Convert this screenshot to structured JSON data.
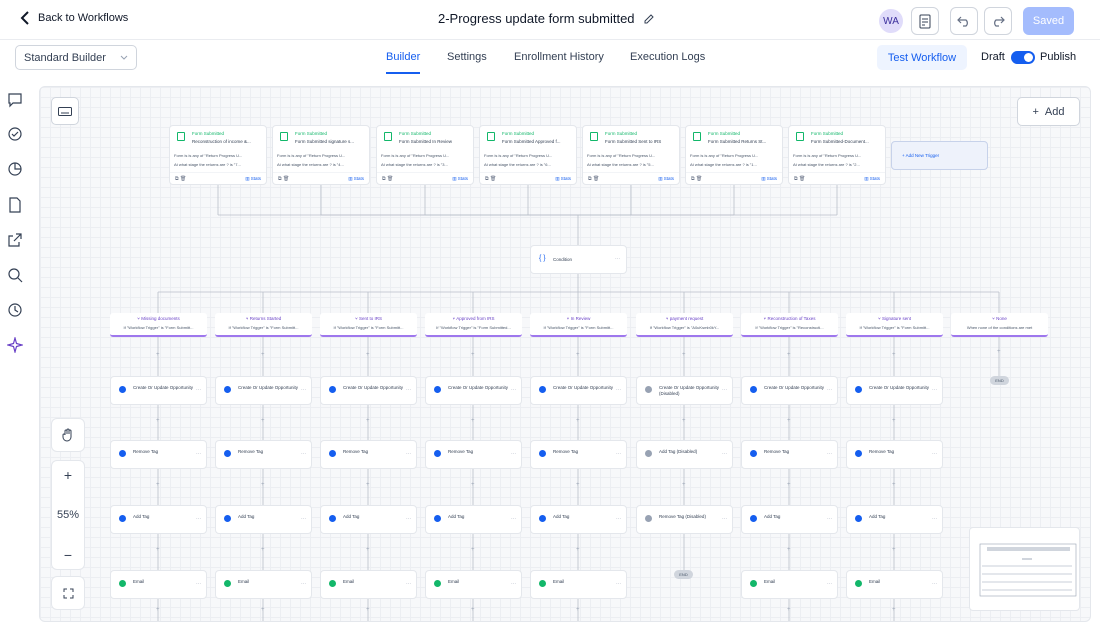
{
  "header": {
    "back_label": "Back to Workflows",
    "workflow_title": "2-Progress update form submitted",
    "avatar_initials": "WA",
    "saved_label": "Saved"
  },
  "subheader": {
    "builder_select": "Standard Builder",
    "tabs": [
      "Builder",
      "Settings",
      "Enrollment History",
      "Execution Logs"
    ],
    "active_tab": "Builder",
    "test_workflow": "Test Workflow",
    "draft_label": "Draft",
    "publish_label": "Publish"
  },
  "canvas": {
    "add_label": "Add",
    "zoom": "55%",
    "add_trigger": "Add New Trigger",
    "condition": "Condition",
    "stats": "Stats",
    "triggers": [
      {
        "type": "Form Submitted",
        "name": "Reconstruction of income &...",
        "line1": "Form is is any of \"Return Progress U...",
        "line2": "At what stage the returns are ? is \"7..."
      },
      {
        "type": "Form Submitted",
        "name": "Form Submitted signature s...",
        "line1": "Form is is any of \"Return Progress U...",
        "line2": "At what stage the returns are ? is \"4..."
      },
      {
        "type": "Form Submitted",
        "name": "Form Submitted In Review",
        "line1": "Form is is any of \"Return Progress U...",
        "line2": "At what stage the returns are ? is \"3..."
      },
      {
        "type": "Form Submitted",
        "name": "Form Submitted Approved f...",
        "line1": "Form is is any of \"Return Progress U...",
        "line2": "At what stage the returns are ? is \"6..."
      },
      {
        "type": "Form Submitted",
        "name": "Form Submitted Sent to IRS",
        "line1": "Form is is any of \"Return Progress U...",
        "line2": "At what stage the returns are ? is \"5..."
      },
      {
        "type": "Form Submitted",
        "name": "Form Submitted Returns St...",
        "line1": "Form is is any of \"Return Progress U...",
        "line2": "At what stage the returns are ? is \"1..."
      },
      {
        "type": "Form Submitted",
        "name": "Form Submitted-Document...",
        "line1": "Form is is any of \"Return Progress U...",
        "line2": "At what stage the returns are ? is \"2..."
      }
    ],
    "branches": [
      {
        "name": "Missing documents",
        "cond": "If \"Workflow Trigger\" is \"Form Submitt..."
      },
      {
        "name": "Returns Started",
        "cond": "If \"Workflow Trigger\" is \"Form Submitt..."
      },
      {
        "name": "Sent to IRS",
        "cond": "If \"Workflow Trigger\" is \"Form Submitt..."
      },
      {
        "name": "Approved from IRS",
        "cond": "If \"Workflow Trigger\" is \"Form Submitted..."
      },
      {
        "name": "In Review",
        "cond": "If \"Workflow Trigger\" is \"Form Submitt..."
      },
      {
        "name": "payment request",
        "cond": "If \"Workflow Trigger\" is \"A0uKsmb0kY..."
      },
      {
        "name": "Reconstruction of Taxes",
        "cond": "If \"Workflow Trigger\" is \"Reconstructi..."
      },
      {
        "name": "Signature sent",
        "cond": "If \"Workflow Trigger\" is \"Form Submitt..."
      },
      {
        "name": "None",
        "cond": "When none of the conditions are met"
      }
    ],
    "actions_row1": [
      "Create Or Update Opportunity",
      "Create Or Update Opportunity",
      "Create Or Update Opportunity",
      "Create Or Update Opportunity",
      "Create Or Update Opportunity",
      "Create Or Update Opportunity (Disabled)",
      "Create Or Update Opportunity",
      "Create Or Update Opportunity"
    ],
    "actions_row2": [
      "Remove Tag",
      "Remove Tag",
      "Remove Tag",
      "Remove Tag",
      "Remove Tag",
      "Add Tag (Disabled)",
      "Remove Tag",
      "Remove Tag"
    ],
    "actions_row3": [
      "Add Tag",
      "Add Tag",
      "Add Tag",
      "Add Tag",
      "Add Tag",
      "Remove Tag (Disabled)",
      "Add Tag",
      "Add Tag"
    ],
    "actions_row4": [
      "Email",
      "Email",
      "Email",
      "Email",
      "Email",
      "",
      "Email",
      "Email"
    ],
    "end_label": "END"
  },
  "colors": {
    "accent": "#155eef",
    "trigger": "#12b76a",
    "branch": "#9e77ed",
    "disabled": "#98a2b3"
  }
}
